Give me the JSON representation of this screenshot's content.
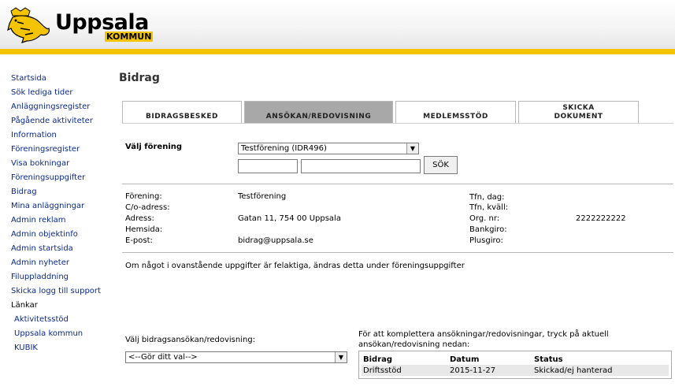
{
  "header": {
    "logo_text": "Uppsala",
    "logo_sub": "KOMMUN",
    "colors": {
      "brand_yellow": "#f5c400",
      "link": "#0a2a8c",
      "active_tab": "#a8a8a8"
    }
  },
  "sidebar": {
    "items": [
      {
        "label": "Startsida"
      },
      {
        "label": "Sök lediga tider"
      },
      {
        "label": "Anläggningsregister"
      },
      {
        "label": "Pågående aktiviteter"
      },
      {
        "label": "Information"
      },
      {
        "label": "Föreningsregister"
      },
      {
        "label": "Visa bokningar"
      },
      {
        "label": "Föreningsuppgifter"
      },
      {
        "label": "Bidrag"
      },
      {
        "label": "Mina anläggningar"
      },
      {
        "label": "Admin reklam"
      },
      {
        "label": "Admin objektinfo"
      },
      {
        "label": "Admin startsida"
      },
      {
        "label": "Admin nyheter"
      },
      {
        "label": "Filuppladdning"
      },
      {
        "label": "Skicka logg till support"
      }
    ],
    "links_heading": "Länkar",
    "links": [
      {
        "label": "Aktivitetsstöd"
      },
      {
        "label": "Uppsala kommun"
      },
      {
        "label": "KUBIK"
      }
    ]
  },
  "main": {
    "title": "Bidrag",
    "tabs": [
      {
        "label": "BIDRAGSBESKED",
        "active": false
      },
      {
        "label": "ANSÖKAN/REDOVISNING",
        "active": true
      },
      {
        "label": "MEDLEMSSTÖD",
        "active": false
      },
      {
        "label_line1": "SKICKA",
        "label_line2": "DOKUMENT",
        "active": false
      }
    ],
    "select_association": {
      "label": "Välj förening",
      "selected": "Testförening (IDR496)",
      "search_button": "SÖK"
    },
    "info_left_labels": [
      "Förening:",
      "C/o-adress:",
      "Adress:",
      "Hemsida:",
      "E-post:"
    ],
    "info_left_values": [
      "Testförening",
      "",
      "Gatan 11, 754 00 Uppsala",
      "",
      "bidrag@uppsala.se"
    ],
    "info_right_labels": [
      "Tfn, dag:",
      "Tfn, kväll:",
      "Org. nr:",
      "Bankgiro:",
      "Plusgiro:"
    ],
    "info_right_values": [
      "",
      "",
      "2222222222",
      "",
      ""
    ],
    "notice": "Om något i ovanstående uppgifter är felaktiga, ändras detta under föreningsuppgifter",
    "application_select": {
      "label": "Välj bidragsansökan/redovisning:",
      "selected": "<--Gör ditt val-->"
    },
    "help_text": "För att komplettera ansökningar/redovisningar, tryck på aktuell ansökan/redovisning nedan:",
    "status_table": {
      "headers": [
        "Bidrag",
        "Datum",
        "Status"
      ],
      "rows": [
        [
          "Driftsstöd",
          "2015-11-27",
          "Skickad/ej hanterad"
        ]
      ]
    }
  }
}
